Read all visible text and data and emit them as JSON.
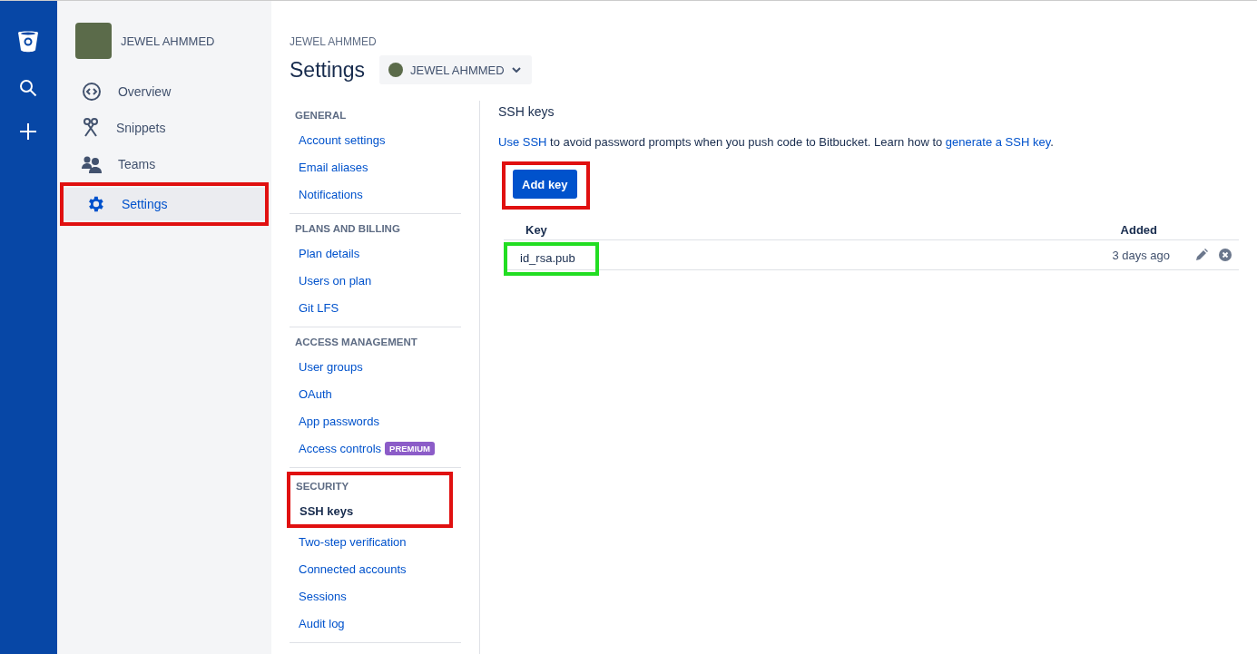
{
  "sidebar": {
    "user": "JEWEL AHMMED",
    "items": [
      {
        "label": "Overview",
        "kind": "overview",
        "selected": false
      },
      {
        "label": "Snippets",
        "kind": "snippets",
        "selected": false
      },
      {
        "label": "Teams",
        "kind": "teams",
        "selected": false
      },
      {
        "label": "Settings",
        "kind": "settings",
        "selected": true,
        "color": "#e01010"
      }
    ]
  },
  "breadcrumb": "JEWEL AHMMED",
  "title": "Settings",
  "account_switcher": {
    "label": "JEWEL AHMMED"
  },
  "settings_nav": {
    "sections": [
      {
        "heading": "GENERAL",
        "items": [
          {
            "label": "Account settings",
            "selected": false
          },
          {
            "label": "Email aliases",
            "selected": false
          },
          {
            "label": "Notifications",
            "selected": false
          }
        ]
      },
      {
        "heading": "PLANS AND BILLING",
        "items": [
          {
            "label": "Plan details",
            "selected": false
          },
          {
            "label": "Users on plan",
            "selected": false
          },
          {
            "label": "Git LFS",
            "selected": false
          }
        ]
      },
      {
        "heading": "ACCESS MANAGEMENT",
        "items": [
          {
            "label": "User groups",
            "selected": false
          },
          {
            "label": "OAuth",
            "selected": false
          },
          {
            "label": "App passwords",
            "selected": false
          },
          {
            "label": "Access controls",
            "selected": false,
            "badge": "PREMIUM"
          }
        ]
      },
      {
        "heading": "SECURITY",
        "color": "#e01010",
        "items": [
          {
            "label": "SSH keys",
            "selected": true
          },
          {
            "label": "Two-step verification",
            "selected": false
          },
          {
            "label": "Connected accounts",
            "selected": false
          },
          {
            "label": "Sessions",
            "selected": false
          },
          {
            "label": "Audit log",
            "selected": false
          }
        ]
      }
    ]
  },
  "content": {
    "heading": "SSH keys",
    "description": [
      {
        "text": "Use SSH",
        "kind": "link"
      },
      {
        "text": " to avoid password prompts when you push code to Bitbucket. Learn how to ",
        "kind": "text"
      },
      {
        "text": "generate a SSH key",
        "kind": "link"
      },
      {
        "text": ".",
        "kind": "text"
      }
    ],
    "add_button": {
      "label": "Add key",
      "color": "#e01010"
    },
    "table": {
      "columns": [
        "Key",
        "Added"
      ],
      "rows": [
        {
          "key": "id_rsa.pub",
          "added": "3 days ago",
          "color": "#22dd22"
        }
      ]
    }
  }
}
